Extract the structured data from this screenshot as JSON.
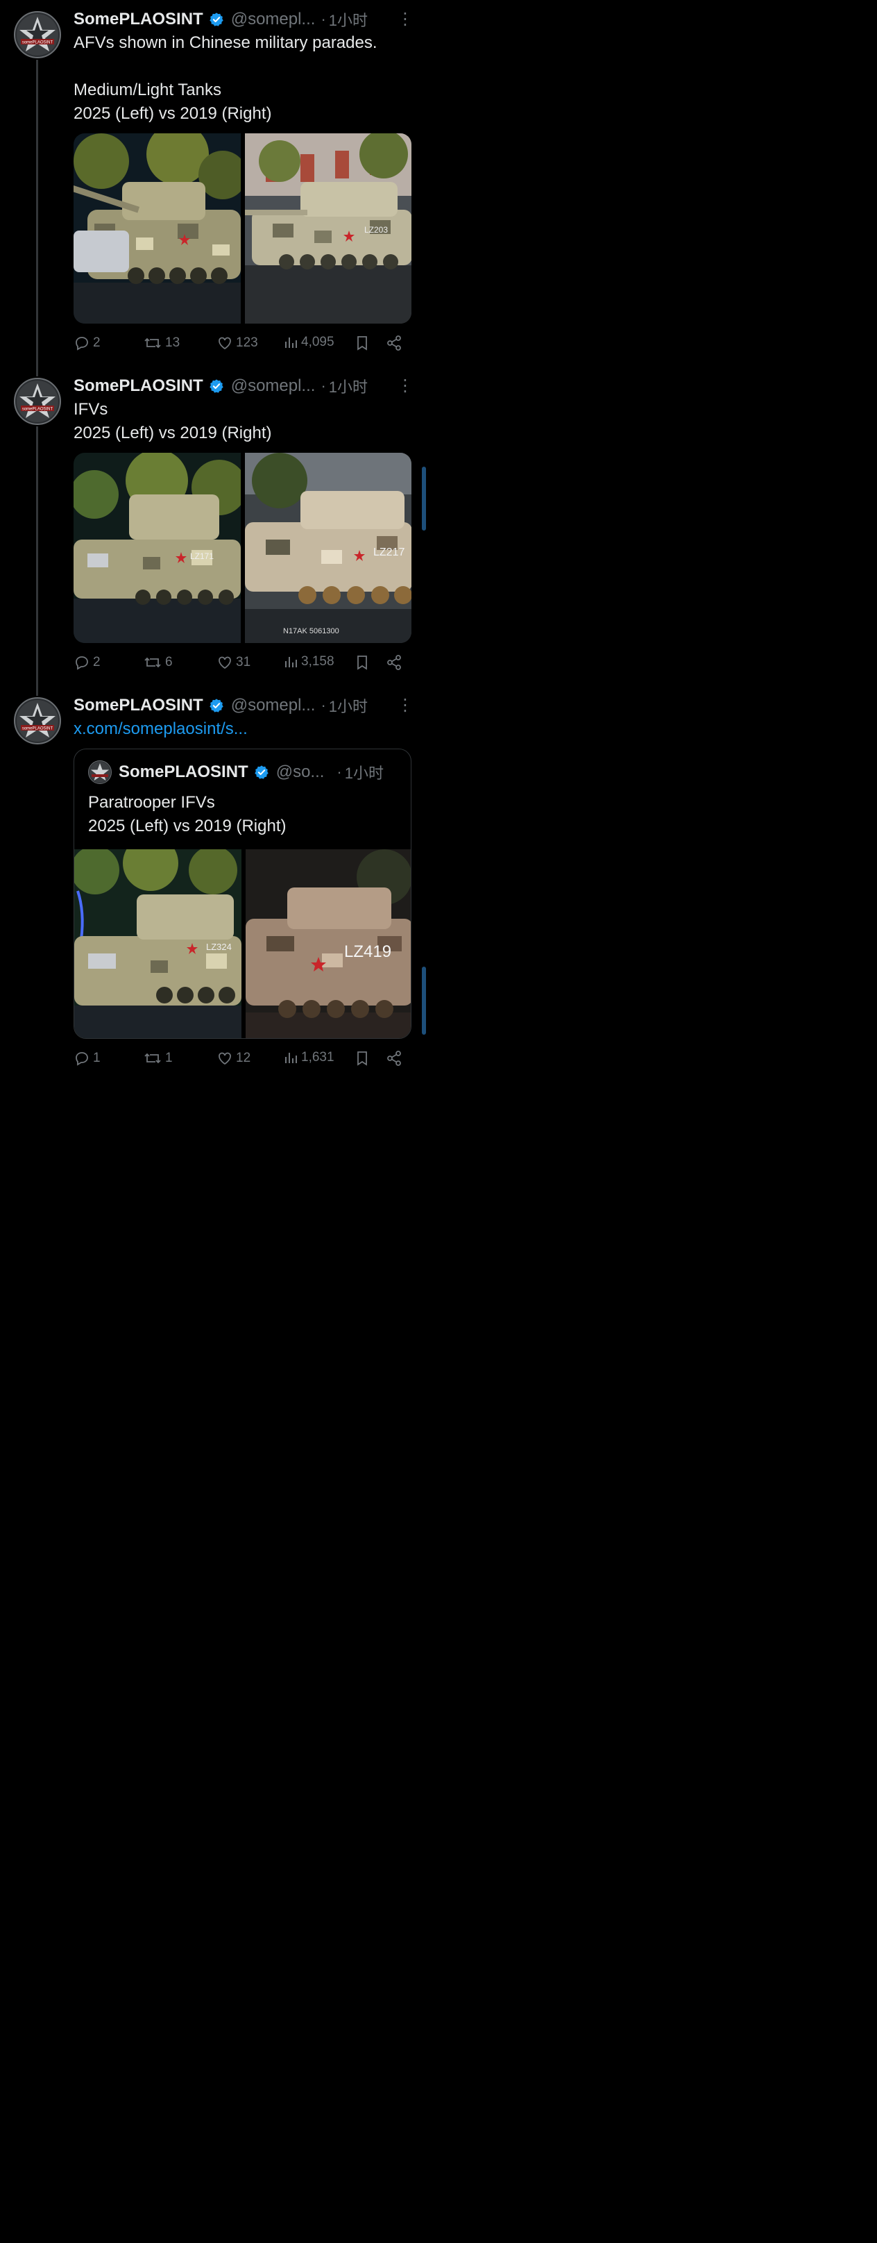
{
  "posts": [
    {
      "name": "SomePLAOSINT",
      "handle": "@somepl...",
      "dot": "·",
      "time": "1小时",
      "text": "AFVs shown in Chinese military parades.\n\nMedium/Light Tanks\n2025 (Left) vs 2019 (Right)",
      "images": [
        {
          "label": "",
          "tone": "night"
        },
        {
          "label": "LZ203",
          "tone": "day"
        }
      ],
      "replies": "2",
      "reposts": "13",
      "likes": "123",
      "views": "4,095"
    },
    {
      "name": "SomePLAOSINT",
      "handle": "@somepl...",
      "dot": "·",
      "time": "1小时",
      "text": "IFVs\n2025 (Left) vs 2019 (Right)",
      "images": [
        {
          "label": "LZ171",
          "tone": "night"
        },
        {
          "label": "LZ217",
          "tone": "day"
        }
      ],
      "plate": "N17AK 5061300",
      "replies": "2",
      "reposts": "6",
      "likes": "31",
      "views": "3,158"
    },
    {
      "name": "SomePLAOSINT",
      "handle": "@somepl...",
      "dot": "·",
      "time": "1小时",
      "link": "x.com/someplaosint/s...",
      "quote": {
        "name": "SomePLAOSINT",
        "handle": "@so...",
        "dot": "·",
        "time": "1小时",
        "text": "Paratrooper IFVs\n2025 (Left) vs 2019 (Right)",
        "images": [
          {
            "label": "LZ324",
            "tone": "night"
          },
          {
            "label": "LZ419",
            "tone": "day"
          }
        ]
      },
      "replies": "1",
      "reposts": "1",
      "likes": "12",
      "views": "1,631"
    }
  ],
  "avatar_text": "somePLAOSINT",
  "colors": {
    "accent": "#1d9bf0",
    "muted": "#71767b",
    "text": "#e7e9ea",
    "bg": "#000000"
  },
  "icons": [
    "reply-icon",
    "repost-icon",
    "like-icon",
    "views-icon",
    "bookmark-icon",
    "share-icon",
    "verified-icon",
    "more-icon"
  ]
}
